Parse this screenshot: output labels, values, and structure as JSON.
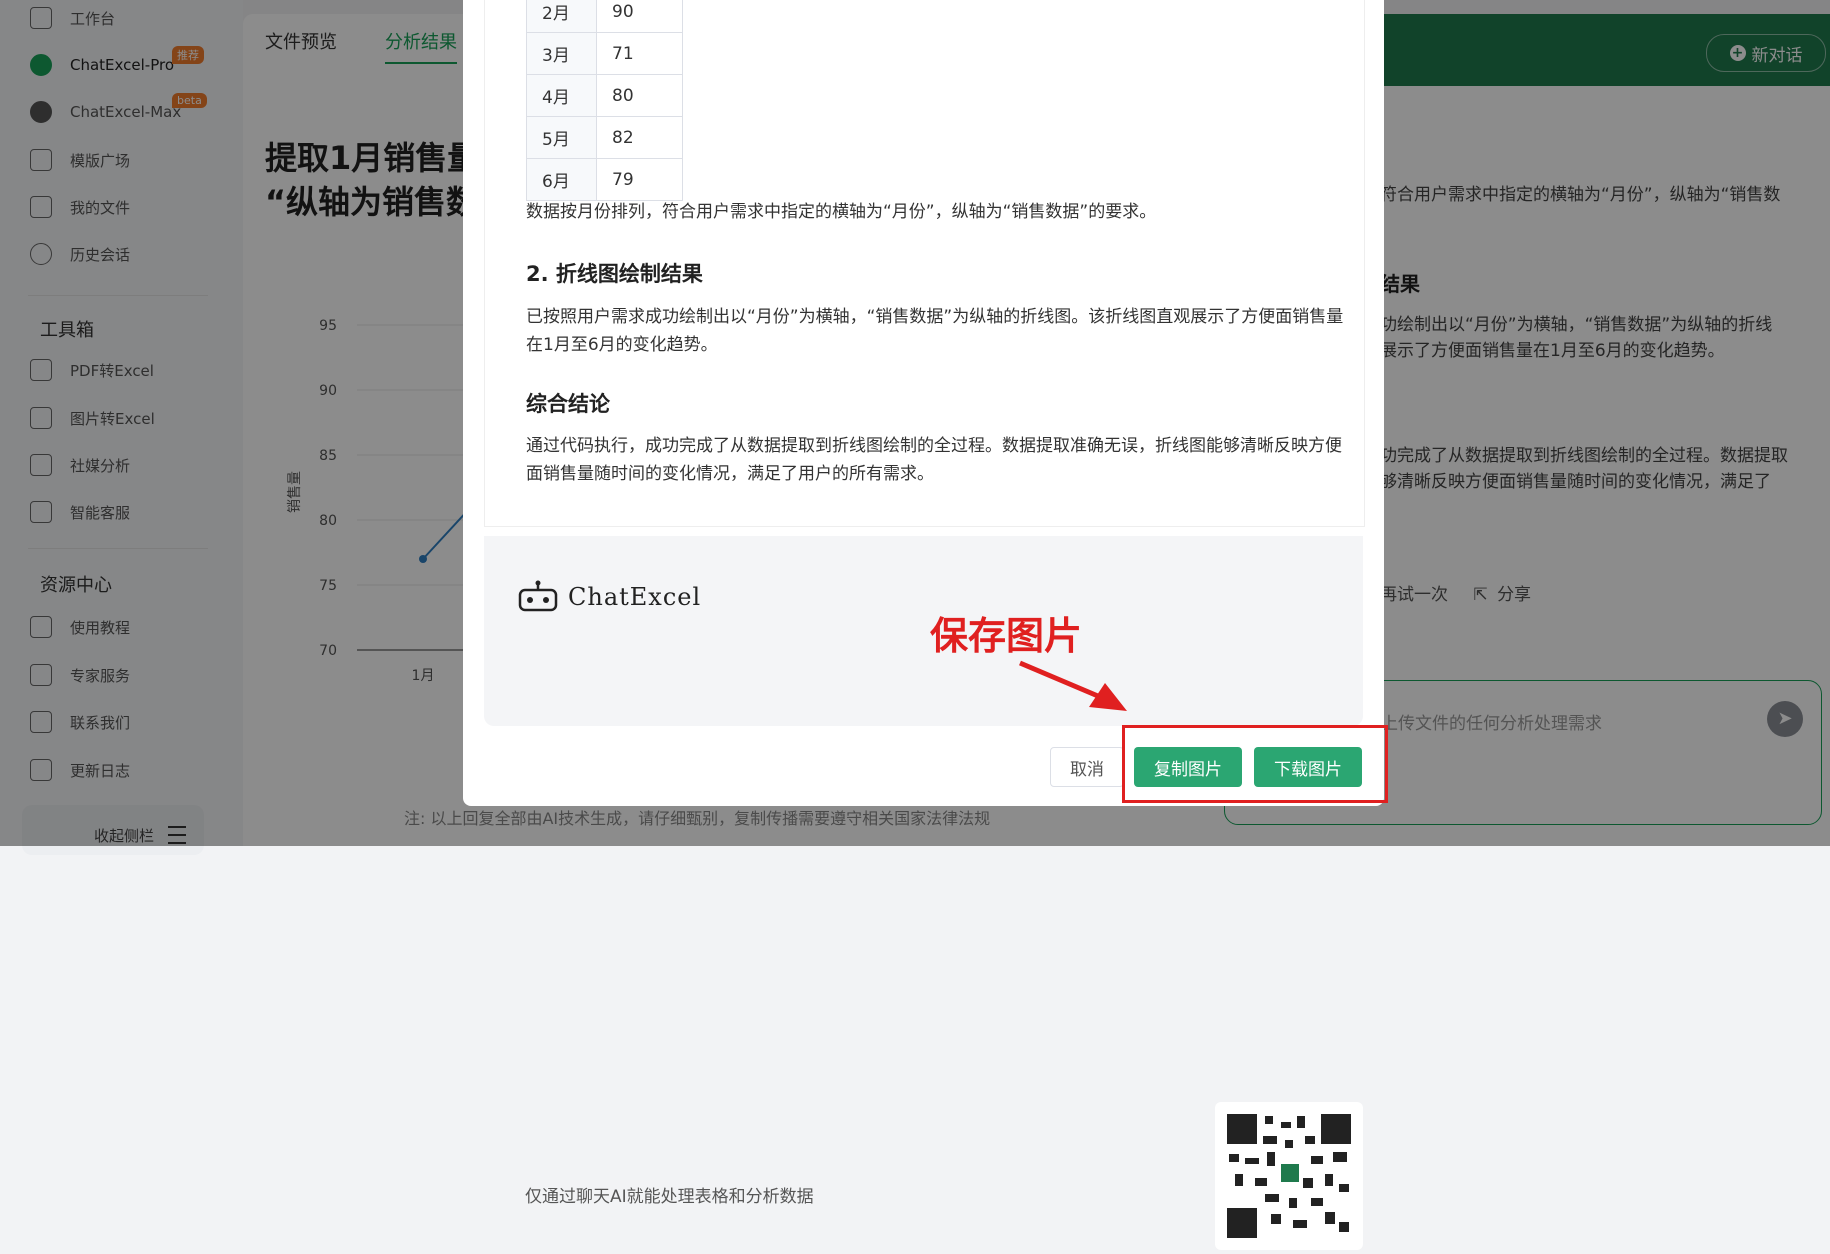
{
  "sidebar": {
    "items": [
      {
        "label": "工作台"
      },
      {
        "label": "ChatExcel-Pro",
        "badge": "推荐"
      },
      {
        "label": "ChatExcel-Max",
        "badge": "beta"
      },
      {
        "label": "模版广场"
      },
      {
        "label": "我的文件"
      },
      {
        "label": "历史会话"
      }
    ],
    "tools_title": "工具箱",
    "tools": [
      {
        "label": "PDF转Excel"
      },
      {
        "label": "图片转Excel"
      },
      {
        "label": "社媒分析"
      },
      {
        "label": "智能客服"
      }
    ],
    "resources_title": "资源中心",
    "resources": [
      {
        "label": "使用教程"
      },
      {
        "label": "专家服务"
      },
      {
        "label": "联系我们"
      },
      {
        "label": "更新日志"
      }
    ],
    "collapse_label": "收起侧栏"
  },
  "tabs": [
    {
      "label": "文件预览"
    },
    {
      "label": "分析结果"
    }
  ],
  "header": {
    "new_chat": "新对话"
  },
  "bg": {
    "title_line1": "提取1月销售量",
    "title_line2": "“纵轴为销售数",
    "right_p1": "符合用户需求中指定的横轴为“月份”，纵轴为“销售数",
    "right_h2": "结果",
    "right_p2a": "功绘制出以“月份”为横轴，“销售数据”为纵轴的折线",
    "right_p2b": "展示了方便面销售量在1月至6月的变化趋势。",
    "right_p3a": "功完成了从数据提取到折线图绘制的全过程。数据提取",
    "right_p3b": "够清晰反映方便面销售量随时间的变化情况，满足了",
    "retry": "再试一次",
    "share": "分享",
    "input_placeholder": "上传文件的任何分析处理需求",
    "footer_note": "注: 以上回复全部由AI技术生成，请仔细甄别，复制传播需要遵守相关国家法律法规"
  },
  "chart_data": {
    "type": "line",
    "ylabel": "销售量",
    "yticks": [
      "95",
      "90",
      "85",
      "80",
      "75",
      "70"
    ],
    "ylim": [
      70,
      95
    ],
    "categories": [
      "1月"
    ],
    "values": [
      77
    ]
  },
  "modal": {
    "table_rows": [
      {
        "month": "2月",
        "value": "90"
      },
      {
        "month": "3月",
        "value": "71"
      },
      {
        "month": "4月",
        "value": "80"
      },
      {
        "month": "5月",
        "value": "82"
      },
      {
        "month": "6月",
        "value": "79"
      }
    ],
    "p1": "数据按月份排列，符合用户需求中指定的横轴为“月份”，纵轴为“销售数据”的要求。",
    "h2": "2. 折线图绘制结果",
    "p2": "已按照用户需求成功绘制出以“月份”为横轴，“销售数据”为纵轴的折线图。该折线图直观展示了方便面销售量在1月至6月的变化趋势。",
    "h3": "综合结论",
    "p3": "通过代码执行，成功完成了从数据提取到折线图绘制的全过程。数据提取准确无误，折线图能够清晰反映方便面销售量随时间的变化情况，满足了用户的所有需求。",
    "brand": "ChatExcel",
    "brand_sub": "仅通过聊天AI就能处理表格和分析数据",
    "cancel": "取消",
    "copy": "复制图片",
    "download": "下载图片",
    "annotation": "保存图片",
    "accent": "#2ba672",
    "annotation_color": "#e02020"
  }
}
